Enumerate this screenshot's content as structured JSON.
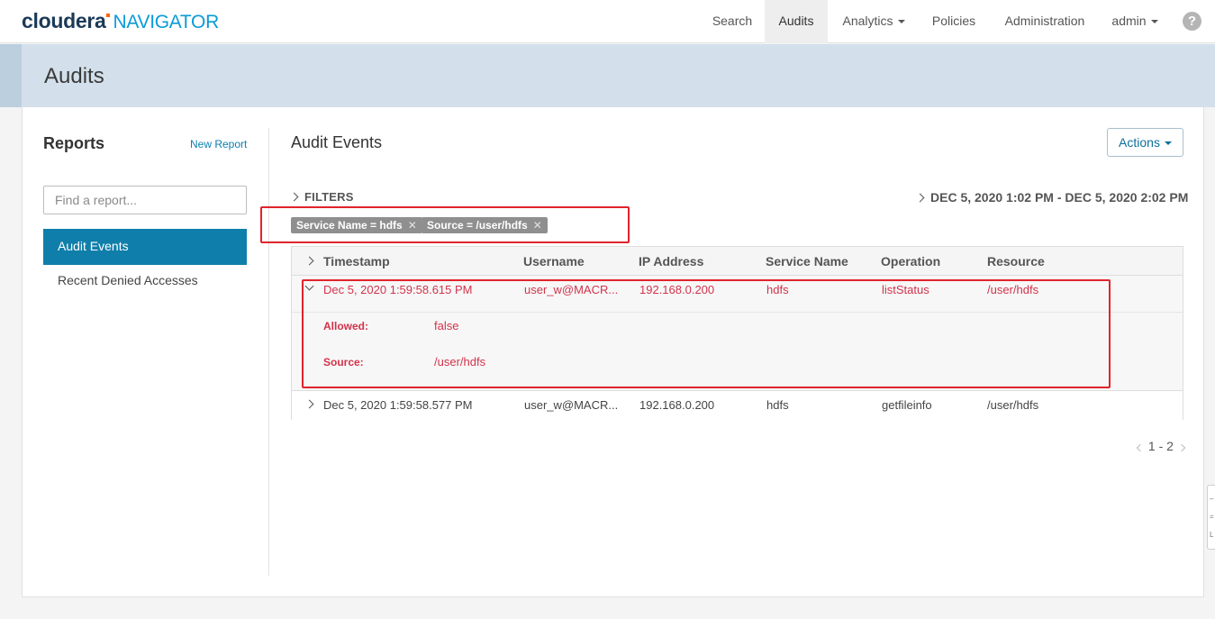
{
  "app": {
    "brand": "cloudera",
    "product": "NAVIGATOR"
  },
  "nav": {
    "search": "Search",
    "audits": "Audits",
    "analytics": "Analytics",
    "policies": "Policies",
    "administration": "Administration",
    "user": "admin",
    "help": "?"
  },
  "page": {
    "title": "Audits"
  },
  "sidebar": {
    "title": "Reports",
    "new_report": "New Report",
    "search_placeholder": "Find a report...",
    "items": [
      {
        "label": "Audit Events",
        "active": true
      },
      {
        "label": "Recent Denied Accesses",
        "active": false
      }
    ]
  },
  "main": {
    "title": "Audit Events",
    "actions_label": "Actions",
    "filters_label": "FILTERS",
    "date_range": "DEC 5, 2020 1:02 PM - DEC 5, 2020 2:02 PM",
    "filter_chips": [
      {
        "label": "Service Name = hdfs"
      },
      {
        "label": "Source = /user/hdfs"
      }
    ],
    "table": {
      "columns": [
        "Timestamp",
        "Username",
        "IP Address",
        "Service Name",
        "Operation",
        "Resource"
      ],
      "rows": [
        {
          "timestamp": "Dec 5, 2020 1:59:58.615 PM",
          "username": "user_w@MACR...",
          "ip": "192.168.0.200",
          "service": "hdfs",
          "operation": "listStatus",
          "resource": "/user/hdfs",
          "expanded": true,
          "details": [
            {
              "key": "Allowed:",
              "value": "false"
            },
            {
              "key": "Source:",
              "value": "/user/hdfs"
            }
          ]
        },
        {
          "timestamp": "Dec 5, 2020 1:59:58.577 PM",
          "username": "user_w@MACR...",
          "ip": "192.168.0.200",
          "service": "hdfs",
          "operation": "getfileinfo",
          "resource": "/user/hdfs",
          "expanded": false
        }
      ]
    },
    "pagination": "1 - 2"
  },
  "colors": {
    "brand_navy": "#1b3a57",
    "brand_blue": "#0a9bd8",
    "active_item": "#0f7eaa",
    "denied_text": "#d2334b",
    "highlight_box": "#e0242c",
    "header_band": "#d3e0eb"
  }
}
